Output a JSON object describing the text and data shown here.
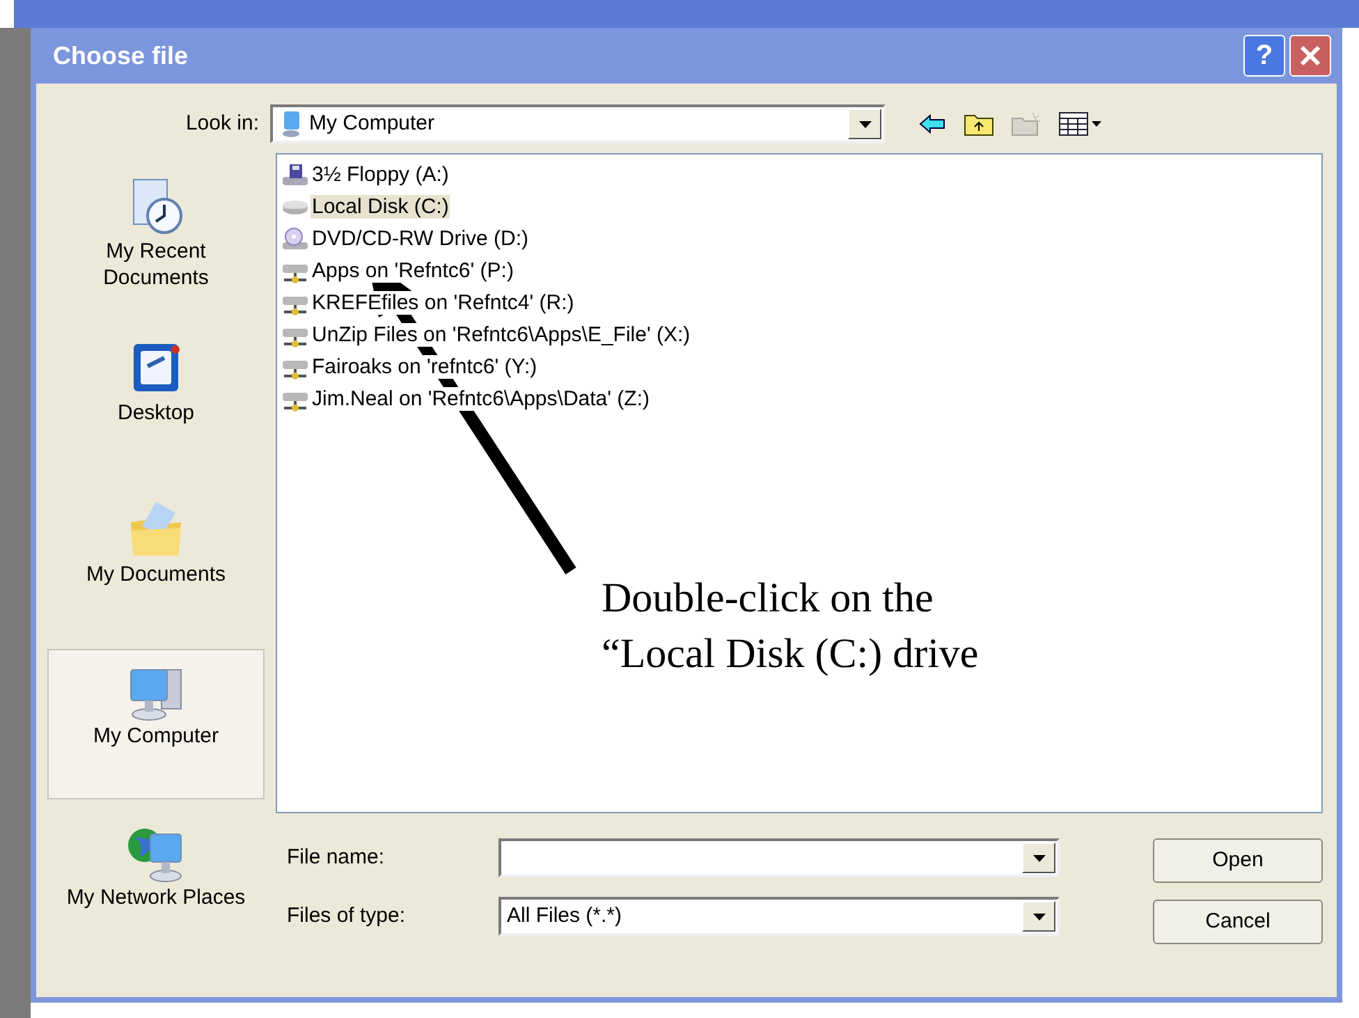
{
  "window": {
    "title": "Choose file",
    "help": "?"
  },
  "look_in": {
    "label": "Look in:",
    "value": "My Computer"
  },
  "places": [
    {
      "label": "My Recent Documents",
      "kind": "recent",
      "selected": false
    },
    {
      "label": "Desktop",
      "kind": "desktop",
      "selected": false
    },
    {
      "label": "My Documents",
      "kind": "documents",
      "selected": false
    },
    {
      "label": "My Computer",
      "kind": "computer",
      "selected": true
    },
    {
      "label": "My Network Places",
      "kind": "network",
      "selected": false
    }
  ],
  "files": [
    {
      "name": "3½ Floppy (A:)",
      "kind": "floppy",
      "selected": false
    },
    {
      "name": "Local Disk (C:)",
      "kind": "disk",
      "selected": true
    },
    {
      "name": "DVD/CD-RW Drive (D:)",
      "kind": "dvd",
      "selected": false
    },
    {
      "name": "Apps on 'Refntc6' (P:)",
      "kind": "network",
      "selected": false
    },
    {
      "name": "KREFEfiles on 'Refntc4' (R:)",
      "kind": "network",
      "selected": false
    },
    {
      "name": "UnZip Files on 'Refntc6\\Apps\\E_File' (X:)",
      "kind": "network",
      "selected": false
    },
    {
      "name": "Fairoaks on 'refntc6' (Y:)",
      "kind": "network",
      "selected": false
    },
    {
      "name": "Jim.Neal on 'Refntc6\\Apps\\Data' (Z:)",
      "kind": "network",
      "selected": false
    }
  ],
  "file_name": {
    "label": "File name:"
  },
  "file_type": {
    "label": "Files of type:",
    "value": "All Files (*.*)"
  },
  "buttons": [
    "Open",
    "Cancel"
  ],
  "annotation": {
    "lines": [
      "Double-click on the",
      "“Local Disk (C:) drive"
    ]
  }
}
